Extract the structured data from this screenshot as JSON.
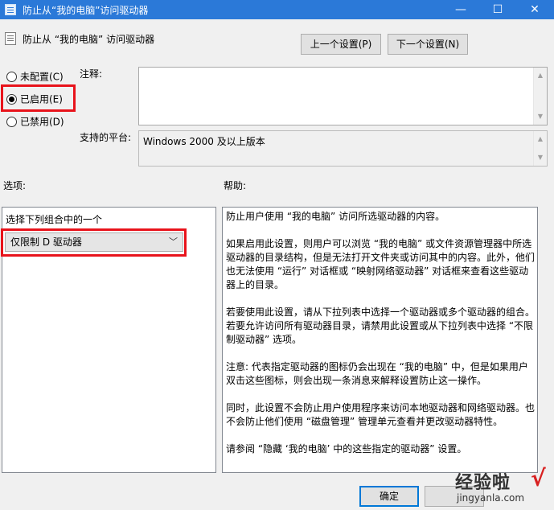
{
  "window": {
    "title": "防止从“我的电脑”访问驱动器",
    "controls": {
      "minimize": "—",
      "maximize": "☐",
      "close": "✕"
    }
  },
  "header": {
    "policy_title": "防止从 “我的电脑” 访问驱动器",
    "prev_button": "上一个设置(P)",
    "next_button": "下一个设置(N)"
  },
  "state": {
    "options": [
      {
        "label": "未配置(C)",
        "checked": false
      },
      {
        "label": "已启用(E)",
        "checked": true
      },
      {
        "label": "已禁用(D)",
        "checked": false
      }
    ]
  },
  "comment": {
    "label": "注释:",
    "value": ""
  },
  "platform": {
    "label": "支持的平台:",
    "value": "Windows 2000 及以上版本"
  },
  "options_section": {
    "label": "选项:",
    "combo_label": "选择下列组合中的一个",
    "selected": "仅限制 D 驱动器"
  },
  "help_section": {
    "label": "帮助:",
    "paragraphs": [
      "防止用户使用 “我的电脑” 访问所选驱动器的内容。",
      "如果启用此设置，则用户可以浏览 “我的电脑” 或文件资源管理器中所选驱动器的目录结构，但是无法打开文件夹或访问其中的内容。此外，他们也无法使用 “运行” 对话框或 “映射网络驱动器” 对话框来查看这些驱动器上的目录。",
      "若要使用此设置，请从下拉列表中选择一个驱动器或多个驱动器的组合。若要允许访问所有驱动器目录，请禁用此设置或从下拉列表中选择 “不限制驱动器” 选项。",
      "注意: 代表指定驱动器的图标仍会出现在 “我的电脑” 中，但是如果用户双击这些图标，则会出现一条消息来解释设置防止这一操作。",
      " 同时，此设置不会防止用户使用程序来访问本地驱动器和网络驱动器。也不会防止他们使用 “磁盘管理” 管理单元查看并更改驱动器特性。",
      "请参阅 “隐藏 ‘我的电脑’ 中的这些指定的驱动器” 设置。"
    ]
  },
  "footer": {
    "ok_button": "确定"
  },
  "watermark": {
    "text": "经验啦",
    "check": "√",
    "url": "jingyanla.com"
  }
}
